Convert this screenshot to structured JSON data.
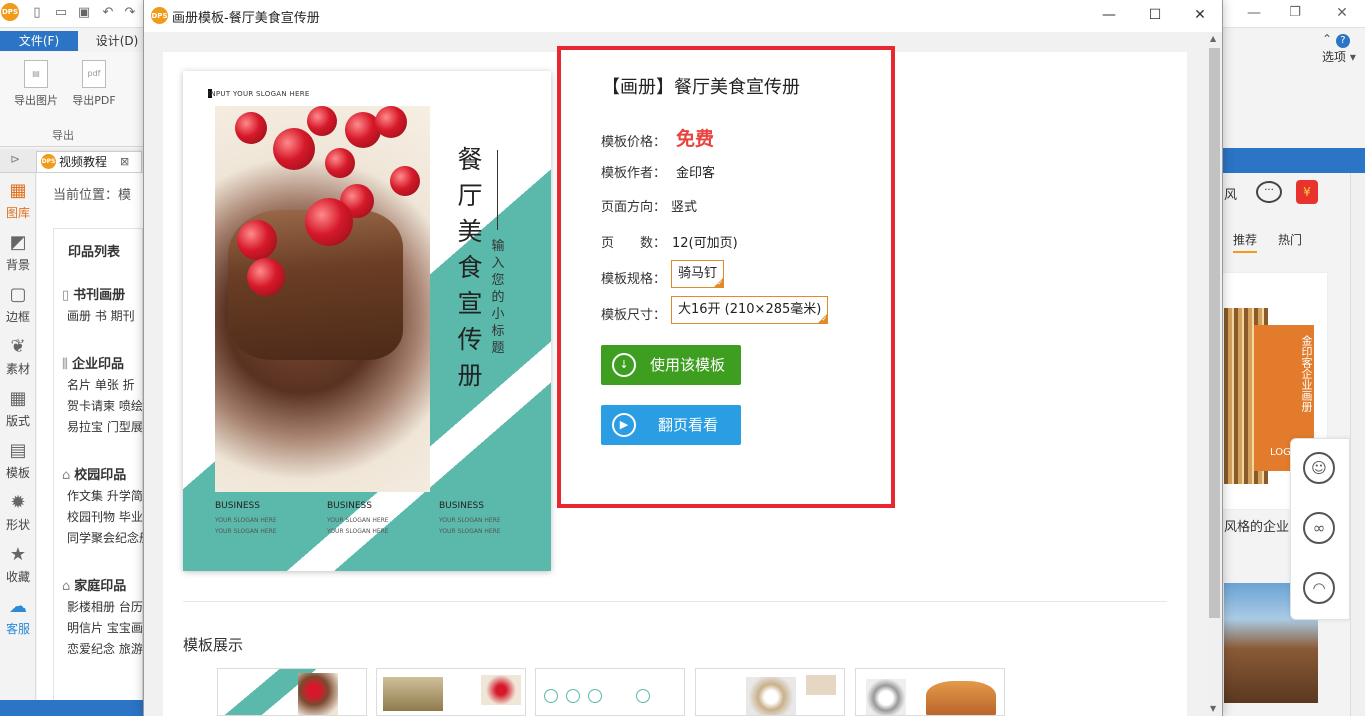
{
  "app": {
    "logo_text": "DPS",
    "menu": {
      "file": "文件(F)",
      "design": "设计(D)"
    },
    "ribbon": {
      "export_image": "导出图片",
      "export_pdf": "导出PDF",
      "group_label": "导出"
    },
    "doc_tab": "视频教程",
    "left_nav": [
      {
        "label": "图库",
        "icon": "gallery-icon"
      },
      {
        "label": "背景",
        "icon": "background-icon"
      },
      {
        "label": "边框",
        "icon": "border-icon"
      },
      {
        "label": "素材",
        "icon": "material-icon"
      },
      {
        "label": "版式",
        "icon": "layout-icon"
      },
      {
        "label": "模板",
        "icon": "template-icon"
      },
      {
        "label": "形状",
        "icon": "shape-icon"
      },
      {
        "label": "收藏",
        "icon": "star-icon"
      },
      {
        "label": "客服",
        "icon": "chat-icon"
      }
    ],
    "breadcrumb": "当前位置：模",
    "panel_title": "印品列表",
    "categories": [
      {
        "title": "书刊画册",
        "links": [
          "画册 书 期刊"
        ]
      },
      {
        "title": "企业印品",
        "links": [
          "名片 单张 折",
          "贺卡请柬 喷绘",
          "易拉宝 门型展"
        ]
      },
      {
        "title": "校园印品",
        "links": [
          "作文集 升学简",
          "校园刊物 毕业",
          "同学聚会纪念册"
        ]
      },
      {
        "title": "家庭印品",
        "links": [
          "影楼相册 台历",
          "明信片 宝宝画",
          "恋爱纪念 旅游"
        ]
      }
    ],
    "right": {
      "options_label": "选项",
      "feng": "风",
      "tab_recommend": "推荐",
      "tab_hot": "热门",
      "thumb_vertical": "金印客企业画册",
      "thumb_logo": "LOG",
      "thumb_caption": "风格的企业",
      "red_bag_glyph": "¥"
    }
  },
  "dialog": {
    "title": "画册模板-餐厅美食宣传册",
    "controls": {
      "minimize": "—",
      "maximize": "☐",
      "close": "✕"
    },
    "cover": {
      "slogan": "INPUT YOUR SLOGAN HERE",
      "title_vertical": "餐厅美食宣传册",
      "subtitle_vertical": "输入您的小标题",
      "business": [
        {
          "title": "BUSINESS",
          "line1": "YOUR SLOGAN HERE",
          "line2": "YOUR SLOGAN HERE"
        },
        {
          "title": "BUSINESS",
          "line1": "YOUR SLOGAN HERE",
          "line2": "YOUR SLOGAN HERE"
        },
        {
          "title": "BUSINESS",
          "line1": "YOUR SLOGAN HERE",
          "line2": "YOUR SLOGAN HERE"
        }
      ],
      "accent_color": "#5bb9ab"
    },
    "info": {
      "title": "【画册】餐厅美食宣传册",
      "price_label": "模板价格：",
      "price_value": "免费",
      "author_label": "模板作者：",
      "author_value": "金印客",
      "orientation_label": "页面方向：",
      "orientation_value": "竖式",
      "pages_label": "页　　数：",
      "pages_value": "12(可加页)",
      "binding_label": "模板规格：",
      "binding_value": "骑马钉",
      "size_label": "模板尺寸：",
      "size_value": "大16开 (210×285毫米)",
      "use_button": "使用该模板",
      "flip_button": "翻页看看",
      "highlight_color": "#e8272e",
      "price_color": "#e8433e"
    },
    "showcase_title": "模板展示"
  }
}
